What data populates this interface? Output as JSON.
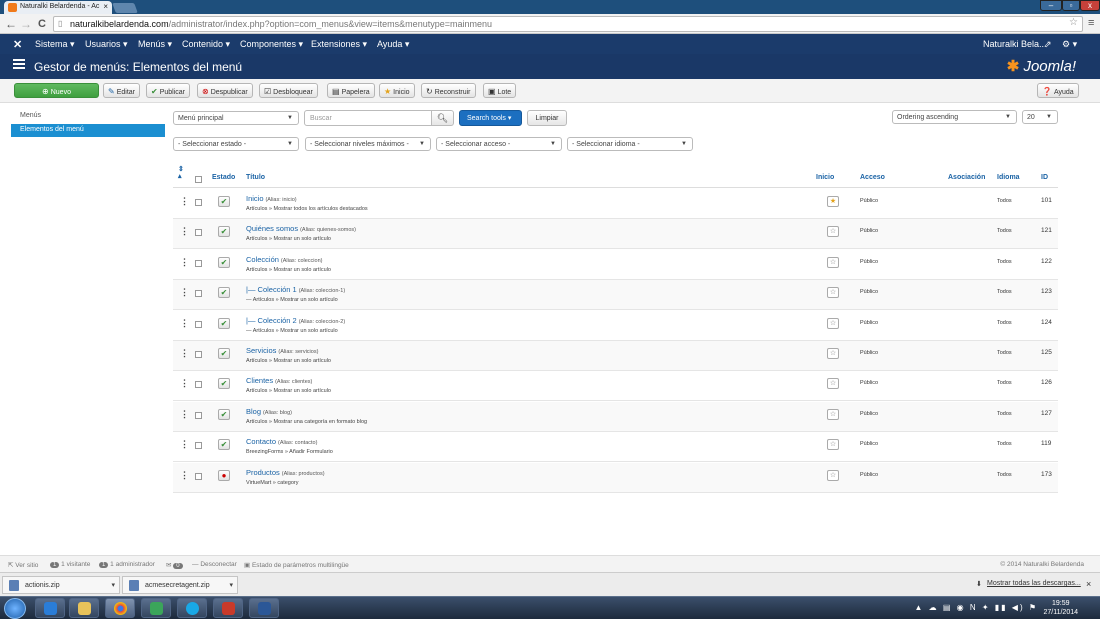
{
  "browser": {
    "tab_title": "Naturalki Belardenda - Ac",
    "tab_close": "×",
    "url_host": "naturalkibelardenda.com",
    "url_path": "/administrator/index.php?option=com_menus&view=items&menutype=mainmenu",
    "back_icon": "←",
    "forward_icon": "→",
    "reload_icon": "C"
  },
  "navbar": {
    "logo_icon": "joomla-icon",
    "items": [
      "Sistema ▾",
      "Usuarios ▾",
      "Menús ▾",
      "Contenido ▾",
      "Componentes ▾",
      "Extensiones ▾",
      "Ayuda ▾"
    ],
    "user": "Naturalki Bela...",
    "gear": "⚙ ▾"
  },
  "header": {
    "title": "Gestor de menús: Elementos del menú",
    "brand": "Joomla!"
  },
  "toolbar": {
    "nuevo": "Nuevo",
    "editar": "Editar",
    "publicar": "Publicar",
    "despublicar": "Despublicar",
    "desbloquear": "Desbloquear",
    "papelera": "Papelera",
    "inicio": "Inicio",
    "reconstruir": "Reconstruir",
    "lote": "Lote",
    "ayuda": "Ayuda"
  },
  "sidebar": {
    "items": [
      "Menús",
      "Elementos del menú"
    ]
  },
  "filters": {
    "menu": "Menú principal",
    "search_placeholder": "Buscar",
    "search_tools": "Search tools ▾",
    "limpiar": "Limpiar",
    "ordering": "Ordering ascending",
    "limit": "20",
    "estado": "- Seleccionar estado -",
    "niveles": "- Seleccionar niveles máximos -",
    "acceso": "- Seleccionar acceso -",
    "idioma": "- Seleccionar idioma -"
  },
  "table": {
    "headers": {
      "sort": "⇕ ▴",
      "estado": "Estado",
      "titulo": "Título",
      "inicio": "Inicio",
      "acceso": "Acceso",
      "asociacion": "Asociación",
      "idioma": "Idioma",
      "id": "ID"
    },
    "rows": [
      {
        "title": "Inicio",
        "alias": "(Alias: inicio)",
        "sub": "Artículos » Mostrar todos los artículos destacados",
        "published": true,
        "home": true,
        "access": "Público",
        "lang": "Todos",
        "id": "101"
      },
      {
        "title": "Quiénes somos",
        "alias": "(Alias: quienes-somos)",
        "sub": "Artículos » Mostrar un solo artículo",
        "published": true,
        "home": false,
        "access": "Público",
        "lang": "Todos",
        "id": "121"
      },
      {
        "title": "Colección",
        "alias": "(Alias: coleccion)",
        "sub": "Artículos » Mostrar un solo artículo",
        "published": true,
        "home": false,
        "access": "Público",
        "lang": "Todos",
        "id": "122"
      },
      {
        "title": "|— Colección 1",
        "alias": "(Alias: coleccion-1)",
        "sub": "— Artículos » Mostrar un solo artículo",
        "published": true,
        "home": false,
        "access": "Público",
        "lang": "Todos",
        "id": "123"
      },
      {
        "title": "|— Colección 2",
        "alias": "(Alias: coleccion-2)",
        "sub": "— Artículos » Mostrar un solo artículo",
        "published": true,
        "home": false,
        "access": "Público",
        "lang": "Todos",
        "id": "124"
      },
      {
        "title": "Servicios",
        "alias": "(Alias: servicios)",
        "sub": "Artículos » Mostrar un solo artículo",
        "published": true,
        "home": false,
        "access": "Público",
        "lang": "Todos",
        "id": "125"
      },
      {
        "title": "Clientes",
        "alias": "(Alias: clientes)",
        "sub": "Artículos » Mostrar un solo artículo",
        "published": true,
        "home": false,
        "access": "Público",
        "lang": "Todos",
        "id": "126"
      },
      {
        "title": "Blog",
        "alias": "(Alias: blog)",
        "sub": "Artículos » Mostrar una categoría en formato blog",
        "published": true,
        "home": false,
        "access": "Público",
        "lang": "Todos",
        "id": "127"
      },
      {
        "title": "Contacto",
        "alias": "(Alias: contacto)",
        "sub": "BreezingForms » Añadir Formulario",
        "published": true,
        "home": false,
        "access": "Público",
        "lang": "Todos",
        "id": "119"
      },
      {
        "title": "Productos",
        "alias": "(Alias: productos)",
        "sub": "VirtueMart » category",
        "published": false,
        "home": false,
        "access": "Público",
        "lang": "Todos",
        "id": "173"
      }
    ]
  },
  "status": {
    "ver_sitio": "Ver sitio",
    "visitors_count": "1",
    "visitors": "1 visitante",
    "admins_count": "1",
    "admins": "1 administrador",
    "messages_count": "0",
    "desconectar": "Desconectar",
    "multilang": "Estado de parámetros multilingüe",
    "copyright": "© 2014 Naturalki Belardenda"
  },
  "downloads": {
    "items": [
      "actionis.zip",
      "acmesecretagent.zip"
    ],
    "show_all": "Mostrar todas las descargas...",
    "close": "×"
  },
  "taskbar": {
    "time": "19:59",
    "date": "27/11/2014",
    "tray_icons": [
      "dropbox-icon",
      "network-icon",
      "volume-icon",
      "flag-icon"
    ]
  },
  "colors": {
    "nav_bg": "#1b3b6b",
    "accent": "#1b8fd1",
    "link": "#1b63a5",
    "new_button": "#4aab4a"
  }
}
